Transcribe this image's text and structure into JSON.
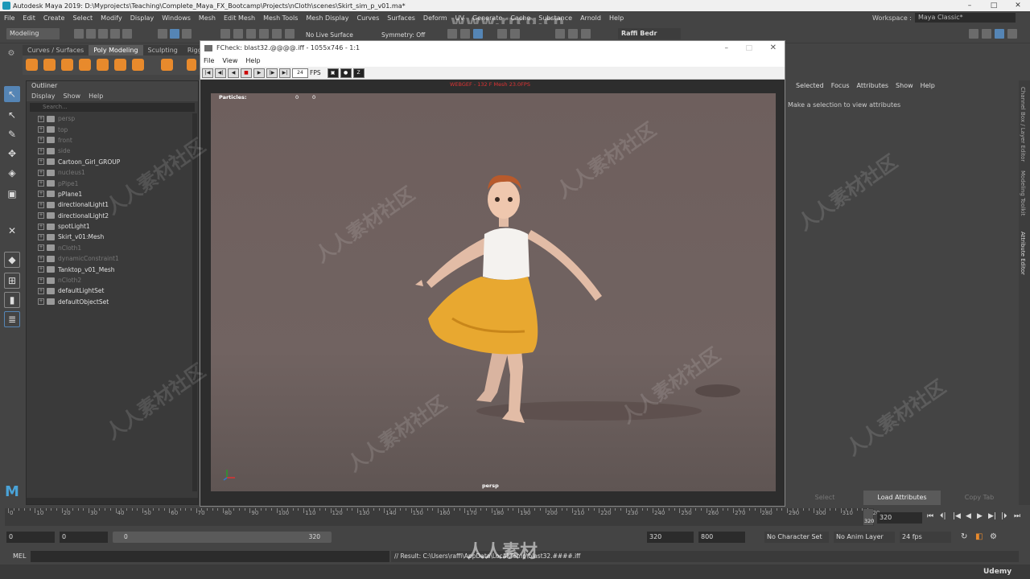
{
  "titlebar": {
    "title": "Autodesk Maya 2019: D:\\Myprojects\\Teaching\\Complete_Maya_FX_Bootcamp\\Projects\\nCloth\\scenes\\Skirt_sim_p_v01.ma*",
    "watermark": "www.rrcg.cn"
  },
  "menubar": {
    "items": [
      "File",
      "Edit",
      "Create",
      "Select",
      "Modify",
      "Display",
      "Windows",
      "Mesh",
      "Edit Mesh",
      "Mesh Tools",
      "Mesh Display",
      "Curves",
      "Surfaces",
      "Deform",
      "UV",
      "Generate",
      "Cache",
      "Substance",
      "Arnold",
      "Help"
    ],
    "workspace_label": "Workspace :",
    "workspace_value": "Maya Classic*"
  },
  "statusline": {
    "menuset": "Modeling",
    "live_surface": "No Live Surface",
    "symmetry": "Symmetry: Off",
    "user": "Raffi Bedr"
  },
  "shelf": {
    "tabs": [
      "Curves / Surfaces",
      "Poly Modeling",
      "Sculpting",
      "Rigging"
    ],
    "active_tab": "Poly Modeling"
  },
  "outliner": {
    "title": "Outliner",
    "menu": [
      "Display",
      "Show",
      "Help"
    ],
    "search_placeholder": "Search...",
    "items": [
      {
        "label": "persp",
        "dim": true
      },
      {
        "label": "top",
        "dim": true
      },
      {
        "label": "front",
        "dim": true
      },
      {
        "label": "side",
        "dim": true
      },
      {
        "label": "Cartoon_Girl_GROUP",
        "dim": false
      },
      {
        "label": "nucleus1",
        "dim": true
      },
      {
        "label": "pPipe1",
        "dim": true
      },
      {
        "label": "pPlane1",
        "dim": false
      },
      {
        "label": "directionalLight1",
        "dim": false
      },
      {
        "label": "directionalLight2",
        "dim": false
      },
      {
        "label": "spotLight1",
        "dim": false
      },
      {
        "label": "Skirt_v01:Mesh",
        "dim": false
      },
      {
        "label": "nCloth1",
        "dim": true
      },
      {
        "label": "dynamicConstraint1",
        "dim": true
      },
      {
        "label": "Tanktop_v01_Mesh",
        "dim": false
      },
      {
        "label": "nCloth2",
        "dim": true
      },
      {
        "label": "defaultLightSet",
        "dim": false
      },
      {
        "label": "defaultObjectSet",
        "dim": false
      }
    ]
  },
  "fcheck": {
    "title": "FCheck: blast32.@@@@.iff - 1055x746 - 1:1",
    "menu": [
      "File",
      "View",
      "Help"
    ],
    "fps_value": "24",
    "fps_label": "FPS",
    "hud_top": "WEBGEF - 132 F Mesh 23.0FPS",
    "particles_label": "Particles:",
    "particles_a": "0",
    "particles_b": "0",
    "camera_label": "persp"
  },
  "attribute_editor": {
    "menu": [
      "Selected",
      "Focus",
      "Attributes",
      "Show",
      "Help"
    ],
    "message": "Make a selection to view attributes",
    "buttons": [
      "Select",
      "Load Attributes",
      "Copy Tab"
    ],
    "side_tabs": [
      "Channel Box / Layer Editor",
      "Modeling Toolkit",
      "Attribute Editor"
    ]
  },
  "timeline": {
    "ticks": [
      "0",
      "10",
      "20",
      "30",
      "40",
      "50",
      "60",
      "70",
      "80",
      "90",
      "100",
      "110",
      "120",
      "130",
      "140",
      "150",
      "160",
      "170",
      "180",
      "190",
      "200",
      "210",
      "220",
      "230",
      "240",
      "250",
      "260",
      "270",
      "280",
      "290",
      "300",
      "310",
      "320"
    ],
    "current_frame": "320",
    "current_marker": "320",
    "range_start": "0",
    "range_start2": "0",
    "range_slider_start": "0",
    "range_slider_end": "320",
    "range_end": "320",
    "range_end2": "800",
    "character_set": "No Character Set",
    "anim_layer": "No Anim Layer",
    "fps": "24 fps"
  },
  "commandline": {
    "label": "MEL",
    "result": "// Result: C:\\Users\\raffi\\AppData\\Local\\Temp\\blast32.####.iff"
  },
  "brand": {
    "udemy": "Udemy",
    "bottom_wm": "人人素材"
  }
}
